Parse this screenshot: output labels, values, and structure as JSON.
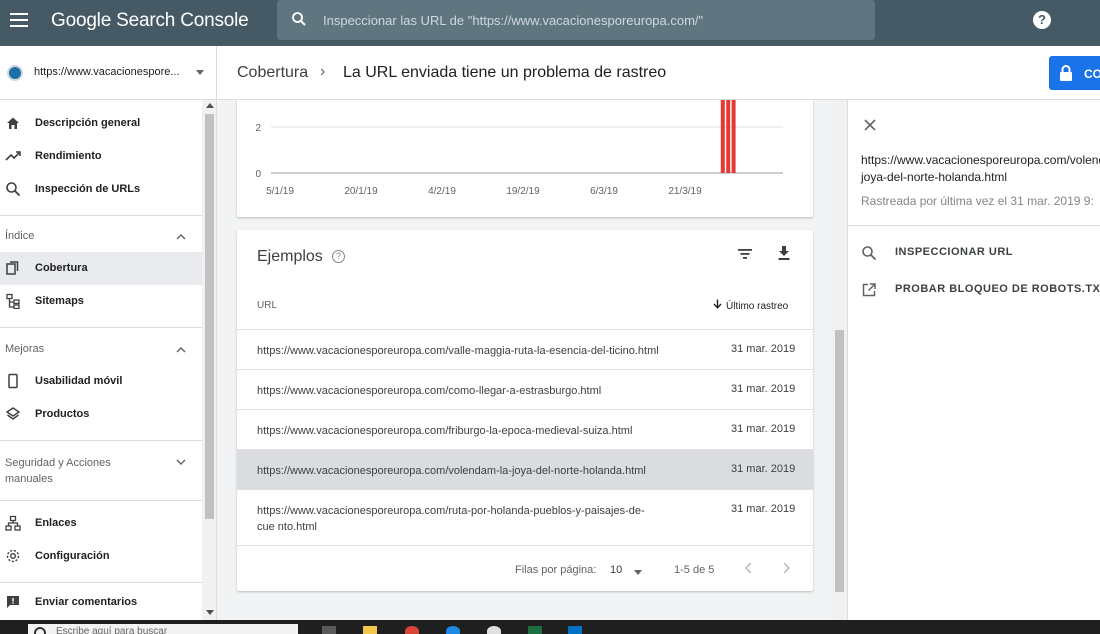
{
  "app": {
    "title": "Google Search Console",
    "search_placeholder": "Inspeccionar las URL de \"https://www.vacacionesporeuropa.com/\"",
    "help_label": "?"
  },
  "header": {
    "property": "https://www.vacacionespore...",
    "breadcrumb_parent": "Cobertura",
    "breadcrumb_sep": "›",
    "breadcrumb_current": "La URL enviada tiene un problema de rastreo",
    "action_label": "CO"
  },
  "sidebar": {
    "items": [
      {
        "label": "Descripción general",
        "icon": "home-icon"
      },
      {
        "label": "Rendimiento",
        "icon": "trending-up-icon"
      },
      {
        "label": "Inspección de URLs",
        "icon": "search-icon"
      },
      {
        "label": "Cobertura",
        "icon": "coverage-icon"
      },
      {
        "label": "Sitemaps",
        "icon": "sitemap-icon"
      },
      {
        "label": "Usabilidad móvil",
        "icon": "phone-icon"
      },
      {
        "label": "Productos",
        "icon": "layers-icon"
      },
      {
        "label": "Enlaces",
        "icon": "links-icon"
      },
      {
        "label": "Configuración",
        "icon": "gear-icon"
      },
      {
        "label": "Enviar comentarios",
        "icon": "feedback-icon"
      }
    ],
    "sections": {
      "index": "Índice",
      "improvements": "Mejoras",
      "security_line1": "Seguridad y Acciones",
      "security_line2": "manuales"
    }
  },
  "chart_data": {
    "type": "bar",
    "x_tick_labels": [
      "5/1/19",
      "20/1/19",
      "4/2/19",
      "19/2/19",
      "6/3/19",
      "21/3/19"
    ],
    "y_tick_labels": [
      "0",
      "2"
    ],
    "series_color": "#e53935",
    "bars": [
      {
        "date": "28/3/19",
        "value": 4
      },
      {
        "date": "29/3/19",
        "value": 4
      },
      {
        "date": "30/3/19",
        "value": 4
      }
    ],
    "ylim": [
      0,
      4
    ]
  },
  "examples": {
    "title": "Ejemplos",
    "col_url": "URL",
    "col_date": "Último rastreo",
    "rows": [
      {
        "url": "https://www.vacacionesporeuropa.com/valle-maggia-ruta-la-esencia-del-ticino.html",
        "date": "31 mar. 2019",
        "selected": false
      },
      {
        "url": "https://www.vacacionesporeuropa.com/como-llegar-a-estrasburgo.html",
        "date": "31 mar. 2019",
        "selected": false
      },
      {
        "url": "https://www.vacacionesporeuropa.com/friburgo-la-epoca-medieval-suiza.html",
        "date": "31 mar. 2019",
        "selected": false
      },
      {
        "url": "https://www.vacacionesporeuropa.com/volendam-la-joya-del-norte-holanda.html",
        "date": "31 mar. 2019",
        "selected": true
      },
      {
        "url": "https://www.vacacionesporeuropa.com/ruta-por-holanda-pueblos-y-paisajes-de-cue nto.html",
        "date": "31 mar. 2019",
        "selected": false
      }
    ],
    "pager": {
      "rows_label": "Filas por página:",
      "rows_value": "10",
      "range": "1-5 de 5"
    }
  },
  "panel": {
    "url": "https://www.vacacionesporeuropa.com/volendam-la-joya-del-norte-holanda.html",
    "crawled": "Rastreada por última vez el 31 mar. 2019 9:",
    "actions": [
      "INSPECCIONAR URL",
      "PROBAR BLOQUEO DE ROBOTS.TXT"
    ]
  },
  "taskbar": {
    "search_text": "Escribe aquí para buscar"
  }
}
